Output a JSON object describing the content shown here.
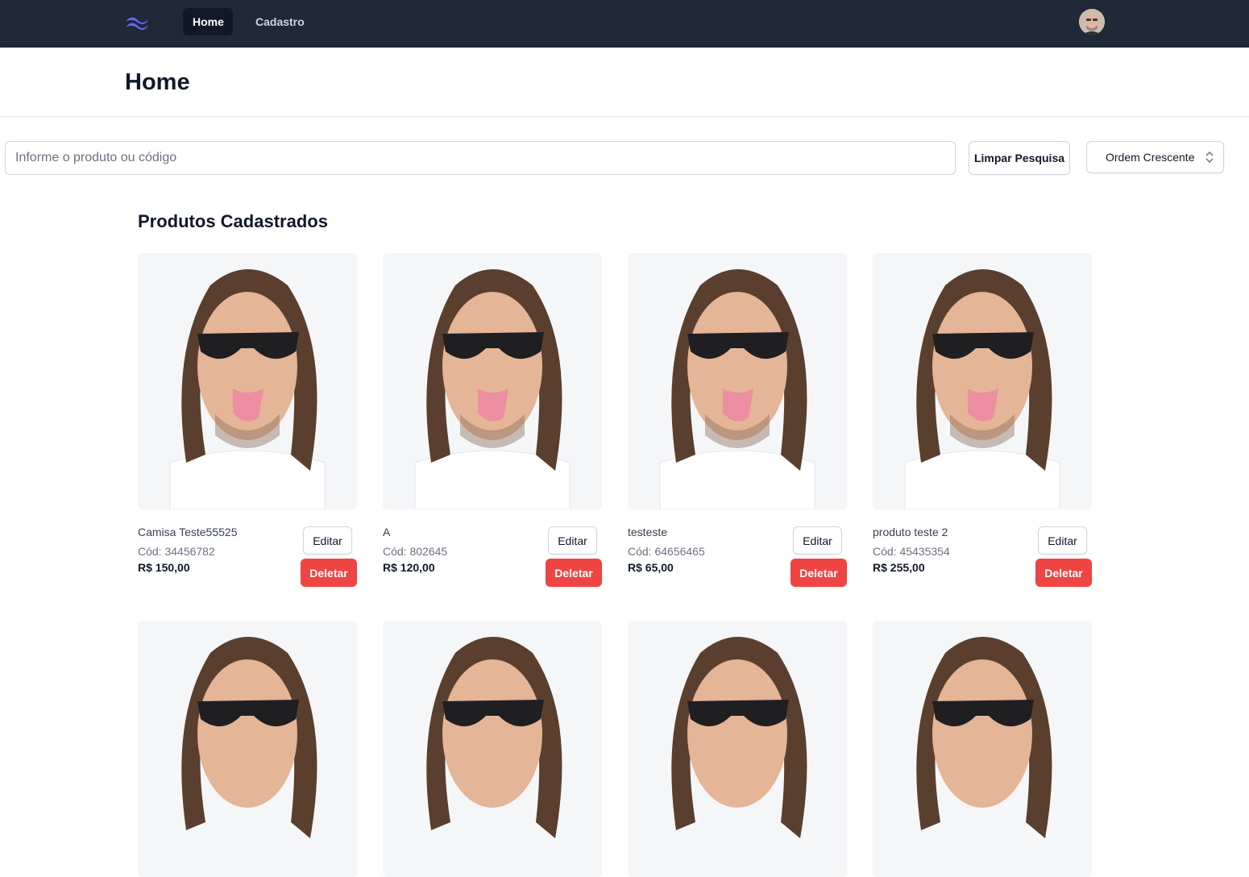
{
  "nav": {
    "logo_icon": "tailwind-logo-icon",
    "links": [
      {
        "label": "Home",
        "active": true
      },
      {
        "label": "Cadastro",
        "active": false
      }
    ],
    "avatar_icon": "user-avatar"
  },
  "header": {
    "title": "Home"
  },
  "search": {
    "placeholder": "Informe o produto ou código",
    "value": "",
    "clear_label": "Limpar Pesquisa",
    "order_selected": "Ordem Crescente",
    "order_icon": "chevron-up-down-icon"
  },
  "section": {
    "title": "Produtos Cadastrados"
  },
  "products": [
    {
      "name": "Camisa Teste55525",
      "code": "Cód: 34456782",
      "price": "R$ 150,00",
      "edit_label": "Editar",
      "delete_label": "Deletar"
    },
    {
      "name": "A",
      "code": "Cód: 802645",
      "price": "R$ 120,00",
      "edit_label": "Editar",
      "delete_label": "Deletar"
    },
    {
      "name": "testeste",
      "code": "Cód: 64656465",
      "price": "R$ 65,00",
      "edit_label": "Editar",
      "delete_label": "Deletar"
    },
    {
      "name": "produto teste 2",
      "code": "Cód: 45435354",
      "price": "R$ 255,00",
      "edit_label": "Editar",
      "delete_label": "Deletar"
    }
  ],
  "colors": {
    "navbar": "#1f2937",
    "accent_logo": "#6366f1",
    "delete": "#ef4444"
  }
}
